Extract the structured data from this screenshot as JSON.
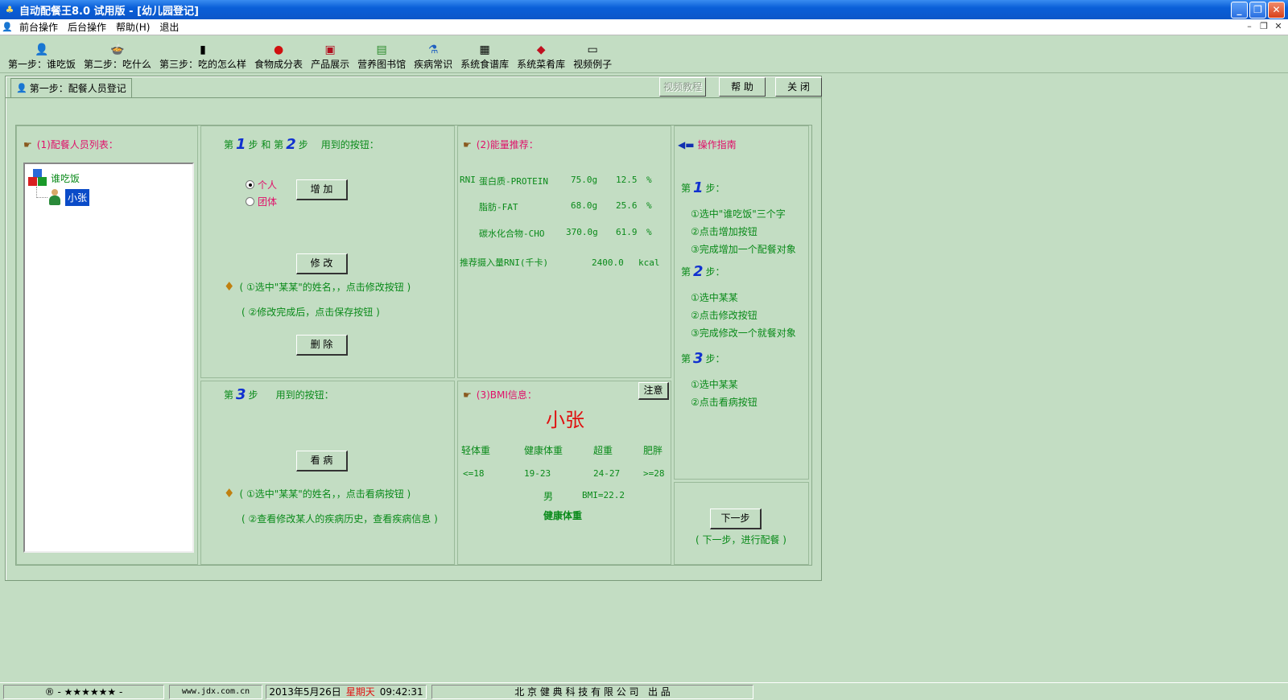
{
  "window": {
    "title": "自动配餐王8.0 试用版 - [幼儿园登记]"
  },
  "menu": {
    "items": [
      "前台操作",
      "后台操作",
      "帮助(H)",
      "退出"
    ]
  },
  "toolbar": {
    "items": [
      {
        "label": "第一步：谁吃饭",
        "icon": "person-icon"
      },
      {
        "label": "第二步：吃什么",
        "icon": "pot-icon"
      },
      {
        "label": "第三步：吃的怎么样",
        "icon": "bars-icon"
      },
      {
        "label": "食物成分表",
        "icon": "apple-icon"
      },
      {
        "label": "产品展示",
        "icon": "box-icon"
      },
      {
        "label": "营养图书馆",
        "icon": "book-icon"
      },
      {
        "label": "疾病常识",
        "icon": "medical-icon"
      },
      {
        "label": "系统食谱库",
        "icon": "menu-book-icon"
      },
      {
        "label": "系统菜肴库",
        "icon": "dish-icon"
      },
      {
        "label": "视频例子",
        "icon": "video-icon"
      }
    ]
  },
  "tab": {
    "label": "第一步：配餐人员登记"
  },
  "top_buttons": {
    "video": "视频教程",
    "help": "帮 助",
    "close": "关 闭"
  },
  "list_section": {
    "title": "(1)配餐人员列表：",
    "tree_root": "谁吃饭",
    "tree_child": "小张"
  },
  "steps12": {
    "title_prefix": "第",
    "num1": "1",
    "title_mid": "步 和 第",
    "num2": "2",
    "title_suffix": "步",
    "buttons_label": "用到的按钮：",
    "radio_individual": "个人",
    "radio_group": "团体",
    "add_button": "增 加",
    "modify_button": "修 改",
    "note1": "( ①选中\"某某\"的姓名，，点击修改按钮 )",
    "note2": "( ②修改完成后，点击保存按钮 )",
    "delete_button": "删 除"
  },
  "step3": {
    "title_prefix": "第",
    "num": "3",
    "title_suffix": "步",
    "buttons_label": "用到的按钮：",
    "doctor_button": "看 病",
    "note1": "( ①选中\"某某\"的姓名，，点击看病按钮 )",
    "note2": "( ②查看修改某人的疾病历史，查看疾病信息 )"
  },
  "energy": {
    "title": "(2)能量推荐：",
    "rows": [
      {
        "prefix": "RNI",
        "name": "蛋白质-PROTEIN",
        "grams": "75.0g",
        "pct": "12.5",
        "unit": "%"
      },
      {
        "prefix": "",
        "name": "脂肪-FAT",
        "grams": "68.0g",
        "pct": "25.6",
        "unit": "%"
      },
      {
        "prefix": "",
        "name": "碳水化合物-CHO",
        "grams": "370.0g",
        "pct": "61.9",
        "unit": "%"
      }
    ],
    "total_label": "推荐摄入量RNI(千卡)",
    "total_value": "2400.0",
    "total_unit": "kcal"
  },
  "bmi": {
    "title": "(3)BMI信息：",
    "notice_button": "注意",
    "name": "小张",
    "categories": [
      "轻体重",
      "健康体重",
      "超重",
      "肥胖"
    ],
    "ranges": [
      "<=18",
      "19-23",
      "24-27",
      ">=28"
    ],
    "gender": "男",
    "value": "BMI=22.2",
    "result": "健康体重"
  },
  "guide": {
    "title": "操作指南",
    "step_prefix": "第",
    "step_suffix": "步：",
    "steps": [
      {
        "num": "1",
        "items": [
          "①选中\"谁吃饭\"三个字",
          "②点击增加按钮",
          "③完成增加一个配餐对象"
        ]
      },
      {
        "num": "2",
        "items": [
          "①选中某某",
          "②点击修改按钮",
          "③完成修改一个就餐对象"
        ]
      },
      {
        "num": "3",
        "items": [
          "①选中某某",
          "②点击看病按钮"
        ]
      }
    ],
    "next_button": "下一步",
    "next_note": "( 下一步，进行配餐 )"
  },
  "statusbar": {
    "stars": "® - ★★★★★★ -",
    "url": "www.jdx.com.cn",
    "date": "2013年5月26日",
    "weekday": "星期天",
    "time": "09:42:31",
    "company": "北 京 健 典 科 技 有 限 公 司   出 品"
  }
}
